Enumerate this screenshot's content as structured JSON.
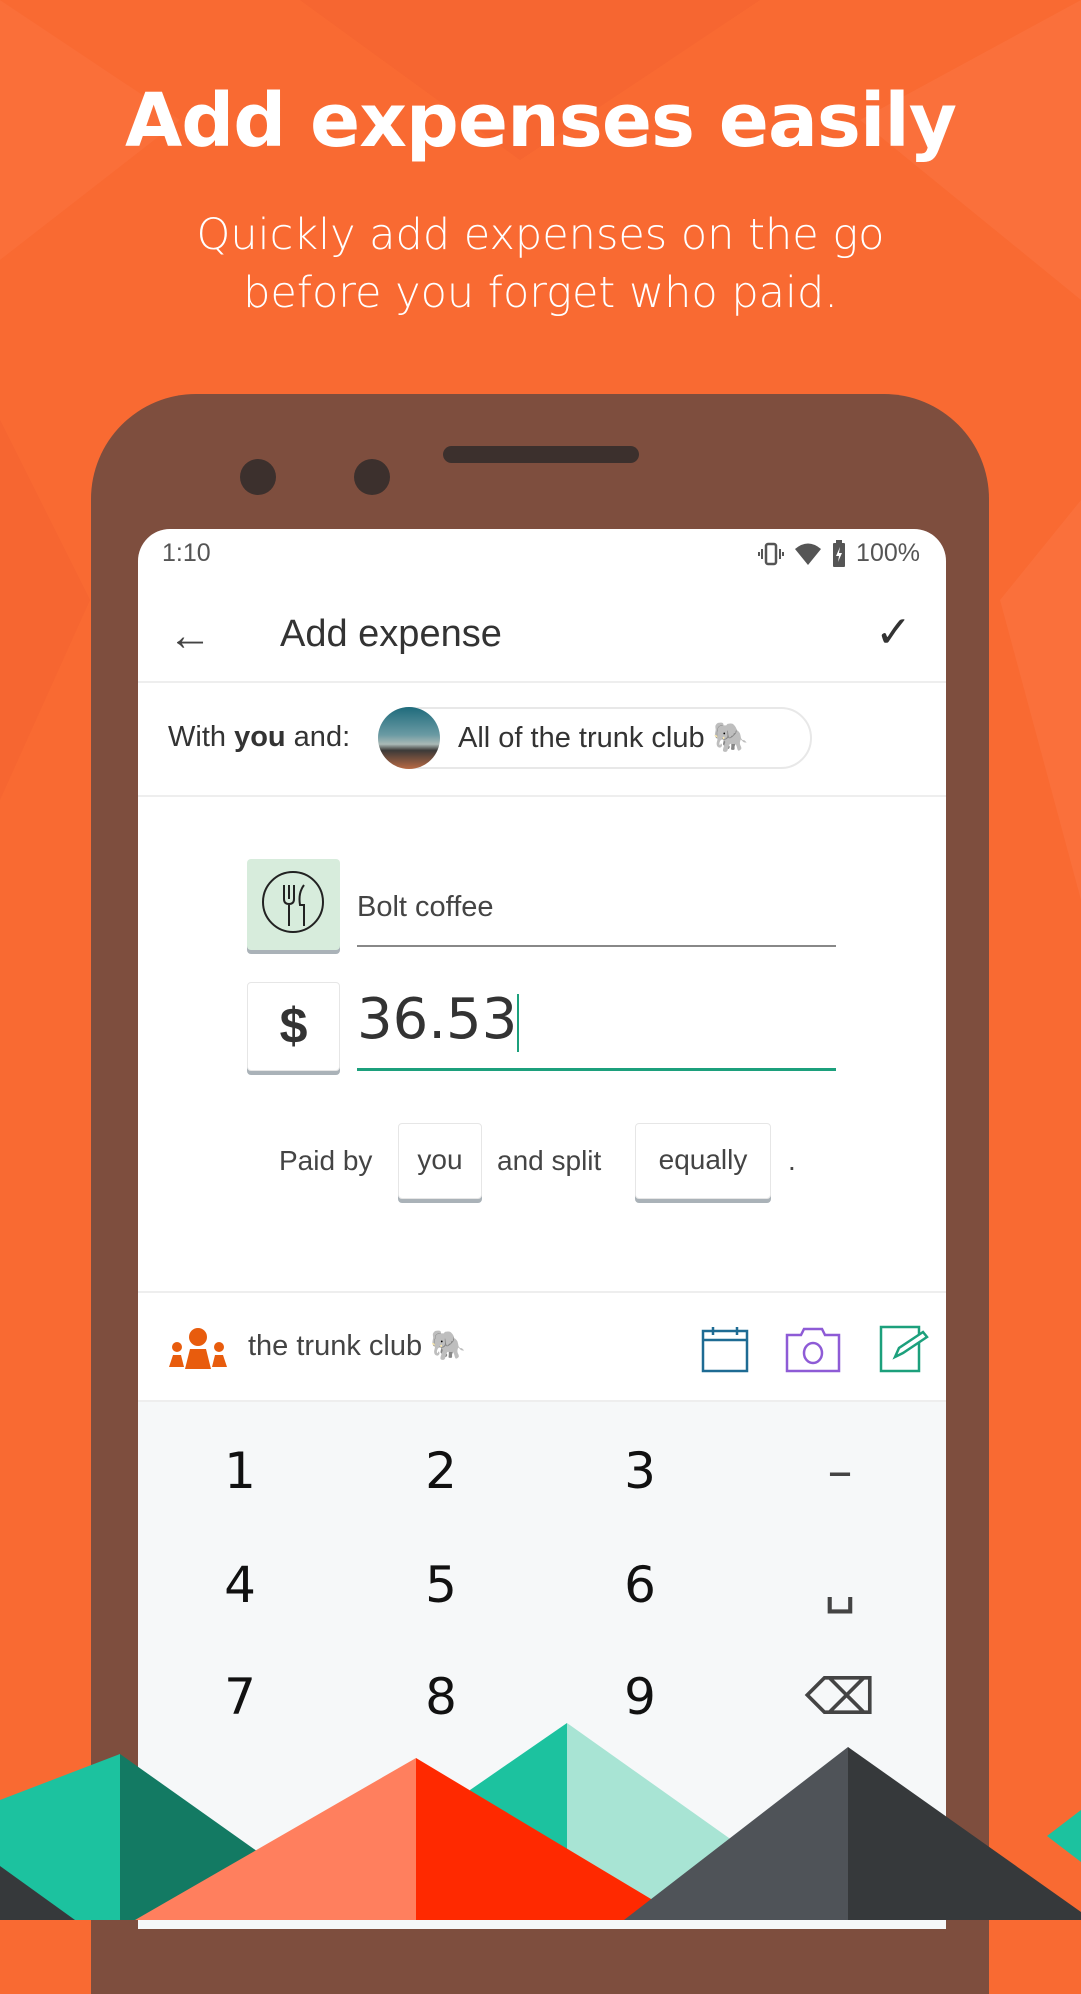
{
  "hero": {
    "title": "Add expenses easily",
    "subtitle_line1": "Quickly add expenses on the go",
    "subtitle_line2": "before you forget who paid."
  },
  "status_bar": {
    "time": "1:10",
    "battery": "100%",
    "icons": [
      "vibrate-icon",
      "wifi-icon",
      "battery-charging-icon"
    ]
  },
  "toolbar": {
    "title": "Add expense",
    "back_icon": "arrow-left-icon",
    "confirm_icon": "check-icon"
  },
  "with_row": {
    "prefix": "With ",
    "bold": "you",
    "suffix": " and:",
    "chip_label": "All of the trunk club 🐘"
  },
  "form": {
    "category_icon": "fork-knife-icon",
    "description": "Bolt coffee",
    "currency": "$",
    "amount": "36.53"
  },
  "split": {
    "paid_by": "Paid by",
    "payer": "you",
    "and_split": "and split",
    "method": "equally",
    "period": "."
  },
  "group_bar": {
    "group_name": "the trunk club 🐘",
    "actions": [
      "calendar-icon",
      "camera-icon",
      "note-icon"
    ]
  },
  "keypad": {
    "keys": [
      "1",
      "2",
      "3",
      "–",
      "4",
      "5",
      "6",
      "␣",
      "7",
      "8",
      "9",
      "⌫"
    ]
  },
  "colors": {
    "background": "#f96a32",
    "accent_green": "#1ca07c",
    "group_orange": "#e85c0d",
    "calendar": "#1e6b93",
    "camera": "#8e5bd6",
    "note": "#1ca07c"
  }
}
